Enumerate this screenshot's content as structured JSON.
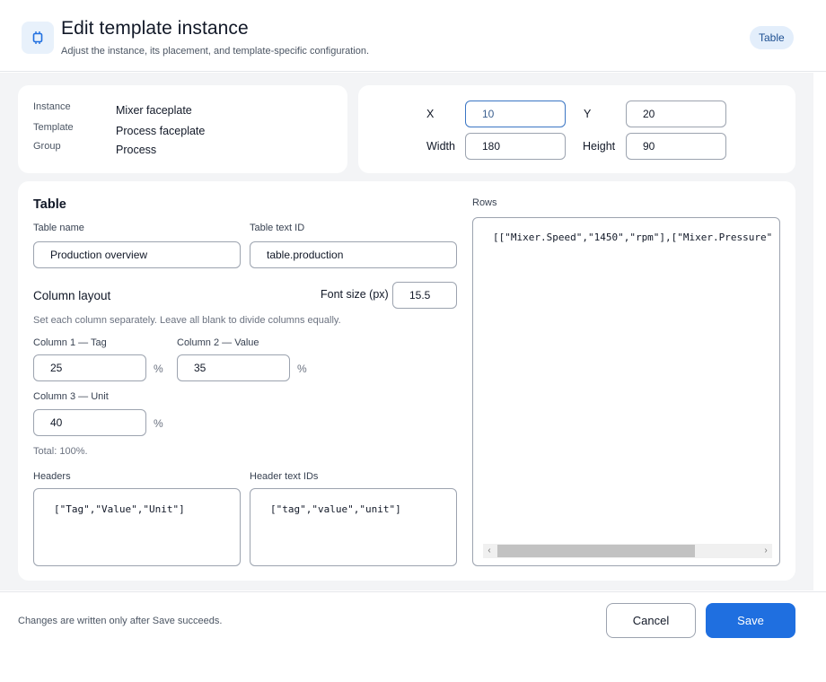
{
  "header": {
    "title": "Edit template instance",
    "subtitle": "Adjust the instance, its placement, and template-specific configuration.",
    "badge": "Table",
    "icon": "chip-icon",
    "accent": "#1f6fe0"
  },
  "info": {
    "instance_label": "Instance",
    "instance_value": "Mixer faceplate",
    "template_label": "Template",
    "template_value": "Process faceplate",
    "group_label": "Group",
    "group_value": "Process"
  },
  "placement": {
    "x_label": "X",
    "x_value": "10",
    "y_label": "Y",
    "y_value": "20",
    "width_label": "Width",
    "width_value": "180",
    "height_label": "Height",
    "height_value": "90"
  },
  "table": {
    "section_title": "Table",
    "name_label": "Table name",
    "name_value": "Production overview",
    "text_id_label": "Table text ID",
    "text_id_value": "table.production",
    "column_layout_title": "Column layout",
    "font_size_label": "Font size (px)",
    "font_size_value": "15.5",
    "column_help": "Set each column separately. Leave all blank to divide columns equally.",
    "col1_label": "Column 1 — Tag",
    "col1_value": "25",
    "col2_label": "Column 2 — Value",
    "col2_value": "35",
    "col3_label": "Column 3 — Unit",
    "col3_value": "40",
    "percent": "%",
    "total": "Total: 100%.",
    "headers_label": "Headers",
    "headers_value": "[\"Tag\",\"Value\",\"Unit\"]",
    "header_ids_label": "Header text IDs",
    "header_ids_value": "[\"tag\",\"value\",\"unit\"]",
    "rows_label": "Rows",
    "rows_value": "[[\"Mixer.Speed\",\"1450\",\"rpm\"],[\"Mixer.Pressure\""
  },
  "footer": {
    "note": "Changes are written only after Save succeeds.",
    "cancel_label": "Cancel",
    "save_label": "Save"
  }
}
